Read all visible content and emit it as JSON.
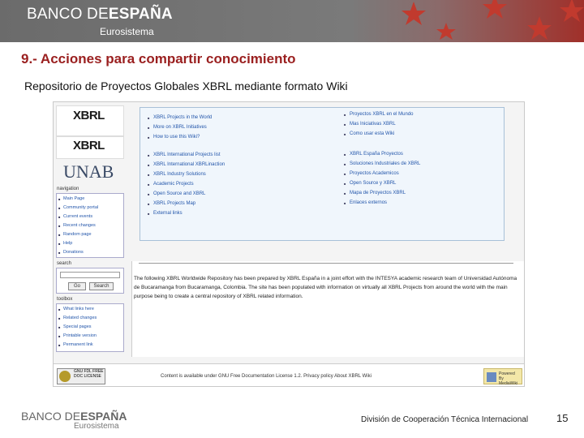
{
  "header": {
    "logo_light": "BANCO DE",
    "logo_bold": "ESPAÑA",
    "subtitle": "Eurosistema"
  },
  "slide": {
    "title": "9.- Acciones para compartir conocimiento",
    "subtitle": "Repositorio de Proyectos Globales XBRL mediante formato Wiki"
  },
  "wiki": {
    "logo1_text": "XBRL",
    "logo2_text": "XBRL",
    "logo3_text": "UNAB",
    "nav_heading": "navigation",
    "nav_items": [
      "Main Page",
      "Community portal",
      "Current events",
      "Recent changes",
      "Random page",
      "Help",
      "Donations"
    ],
    "search_heading": "search",
    "go_label": "Go",
    "search_label": "Search",
    "toolbox_heading": "toolbox",
    "toolbox_items": [
      "What links here",
      "Related changes",
      "Special pages",
      "Printable version",
      "Permanent link"
    ],
    "left_col": [
      "XBRL Projects in the World",
      "More on XBRL Initiatives",
      "How to use this Wiki?",
      "XBRL International Projects list",
      "XBRL International XBRLinaction",
      "XBRL Industry Solutions",
      "Academic Projects",
      "Open Source and XBRL",
      "XBRL Projects Map",
      "External links"
    ],
    "right_col": [
      "Proyectos XBRL en el Mundo",
      "Mas Iniciativas XBRL",
      "Como usar esta Wiki",
      "XBRL España Proyectos",
      "Soluciones Industriales de XBRL",
      "Proyectos Academicos",
      "Open Source y XBRL",
      "Mapa de Proyectos XBRL",
      "Enlaces externos"
    ],
    "paragraph": "The following XBRL Worldwide Repository has been prepared by XBRL España in a joint effort with the INTESYA academic research team of Universidad Autónoma de Bucaramanga from Bucaramanga, Colombia. The site has been populated with information on virtually all XBRL Projects from around the world with the main purpose being to create a central repository of XBRL related information.",
    "footer_logo_text": "GNU FDL FREE DOC LICENSE",
    "footer_links": "Content is available under GNU Free Documentation License 1.2.    Privacy policy    About XBRL Wiki",
    "mediawiki_text": "Powered By MediaWiki"
  },
  "footer": {
    "logo_light": "BANCO DE",
    "logo_bold": "ESPAÑA",
    "subtitle": "Eurosistema",
    "division": "División de Cooperación Técnica Internacional",
    "page_number": "15"
  },
  "colors": {
    "title_red": "#9a1f1f",
    "link_blue": "#2255aa",
    "header_gray": "#6b6b6b"
  }
}
